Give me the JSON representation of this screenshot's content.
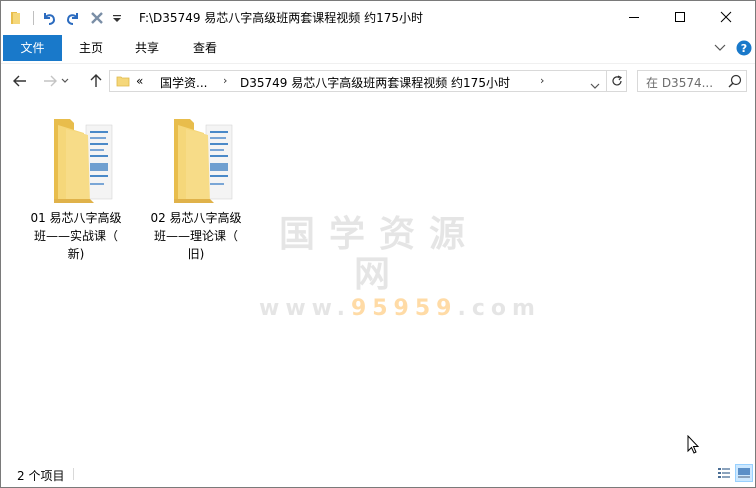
{
  "window": {
    "title": "F:\\D35749 易芯八字高级班两套课程视频 约175小时"
  },
  "quick_access": {
    "items": [
      "folder-icon",
      "undo-icon",
      "redo-icon",
      "delete-icon",
      "customize-dropdown-icon"
    ]
  },
  "ribbon": {
    "tabs": [
      {
        "label": "文件",
        "active": true
      },
      {
        "label": "主页"
      },
      {
        "label": "共享"
      },
      {
        "label": "查看"
      }
    ]
  },
  "address": {
    "overflow": "«",
    "crumbs": [
      "国学资...",
      "D35749 易芯八字高级班两套课程视频 约175小时"
    ],
    "search_placeholder": "在 D3574..."
  },
  "items": [
    {
      "line1": "01 易芯八字高级",
      "line2": "班——实战课（",
      "line3": "新)"
    },
    {
      "line1": "02 易芯八字高级",
      "line2": "班——理论课（",
      "line3": "旧)"
    }
  ],
  "watermark": {
    "main": "国学资源网",
    "sub_prefix": "www.",
    "sub_num": "95959",
    "sub_suffix": ".com"
  },
  "status": {
    "count": "2 个项目"
  },
  "colors": {
    "accent": "#1979ca",
    "folder": "#f5d77a",
    "folder_dark": "#e8bd4c"
  }
}
